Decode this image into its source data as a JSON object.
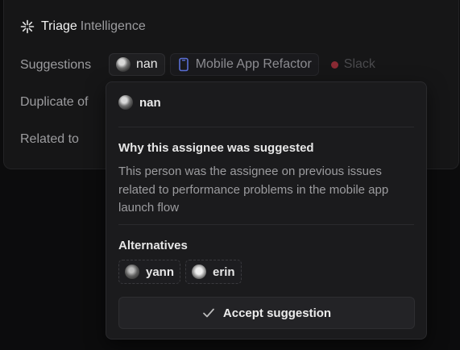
{
  "triage": {
    "title_strong": "Triage",
    "title_rest": "Intelligence",
    "icon": "sparkle-icon",
    "rows": {
      "suggestions_label": "Suggestions",
      "duplicate_label": "Duplicate of",
      "related_label": "Related to"
    },
    "suggestions": {
      "assignee": "nan",
      "project": "Mobile App Refactor",
      "project_icon": "phone-icon",
      "channel": "Slack",
      "channel_color": "#8a2a33"
    }
  },
  "popover": {
    "assignee": "nan",
    "why_title": "Why this assignee was suggested",
    "why_body": "This person was the assignee on previous issues related to performance problems in the mobile app launch flow",
    "alternatives_title": "Alternatives",
    "alternatives": [
      {
        "name": "yann"
      },
      {
        "name": "erin"
      }
    ],
    "accept_label": "Accept suggestion",
    "accept_icon": "check-icon"
  },
  "colors": {
    "background": "#0c0c0d",
    "panel": "#161617",
    "popover": "#1b1b1d",
    "muted_text": "#9c9c9f"
  }
}
